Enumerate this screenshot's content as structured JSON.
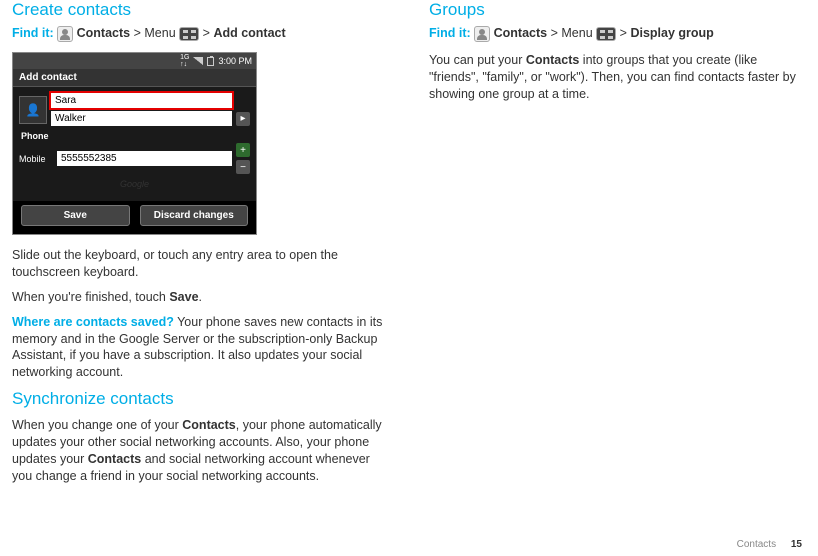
{
  "left": {
    "h_create": "Create contacts",
    "findit_label": "Find it:",
    "contacts_word": "Contacts",
    "gt": ">",
    "menu_word": "Menu",
    "add_contact": "Add contact",
    "p_slide": "Slide out the keyboard, or touch any entry area to open the touchscreen keyboard.",
    "p_finished_a": "When you're finished, touch ",
    "p_finished_b": "Save",
    "p_finished_c": ".",
    "q_where": "Where are contacts saved?",
    "p_where": " Your phone saves new contacts in its memory and in the Google Server or the subscription-only Backup Assistant, if you have a subscription. It also updates your social networking account.",
    "h_sync": "Synchronize contacts",
    "p_sync_a": "When you change one of your ",
    "p_sync_b": "Contacts",
    "p_sync_c": ", your phone automatically updates your other social networking accounts. Also, your phone updates your ",
    "p_sync_d": "Contacts",
    "p_sync_e": " and social networking account whenever you change a friend in your social networking accounts."
  },
  "right": {
    "h_groups": "Groups",
    "findit_label": "Find it:",
    "contacts_word": "Contacts",
    "gt": ">",
    "menu_word": "Menu",
    "display_group": "Display group",
    "p1_a": "You can put your ",
    "p1_b": "Contacts",
    "p1_c": " into groups that you create (like \"friends\", \"family\", or \"work\"). Then, you can find contacts faster by showing one group at a time."
  },
  "phone": {
    "time": "3:00 PM",
    "title": "Add contact",
    "first": "Sara",
    "last": "Walker",
    "phone_section": "Phone",
    "mobile_label": "Mobile",
    "mobile_value": "5555552385",
    "watermark": "Google",
    "save": "Save",
    "discard": "Discard changes"
  },
  "footer": {
    "section": "Contacts",
    "page": "15"
  }
}
